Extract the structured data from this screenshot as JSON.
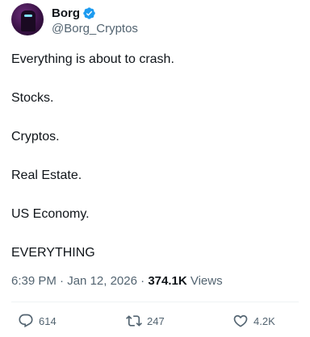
{
  "author": {
    "display_name": "Borg",
    "handle": "@Borg_Cryptos",
    "verified": true,
    "verified_color": "#1d9bf0"
  },
  "body": {
    "lines": [
      "Everything is about to crash.",
      "Stocks.",
      "Cryptos.",
      "Real Estate.",
      "US Economy.",
      "EVERYTHING"
    ]
  },
  "meta": {
    "time": "6:39 PM",
    "separator": " · ",
    "date": "Jan 12, 2026",
    "views_count": "374.1K",
    "views_label": " Views"
  },
  "actions": {
    "replies": "614",
    "reposts": "247",
    "likes": "4.2K",
    "icons": [
      "reply-icon",
      "repost-icon",
      "like-icon"
    ]
  }
}
